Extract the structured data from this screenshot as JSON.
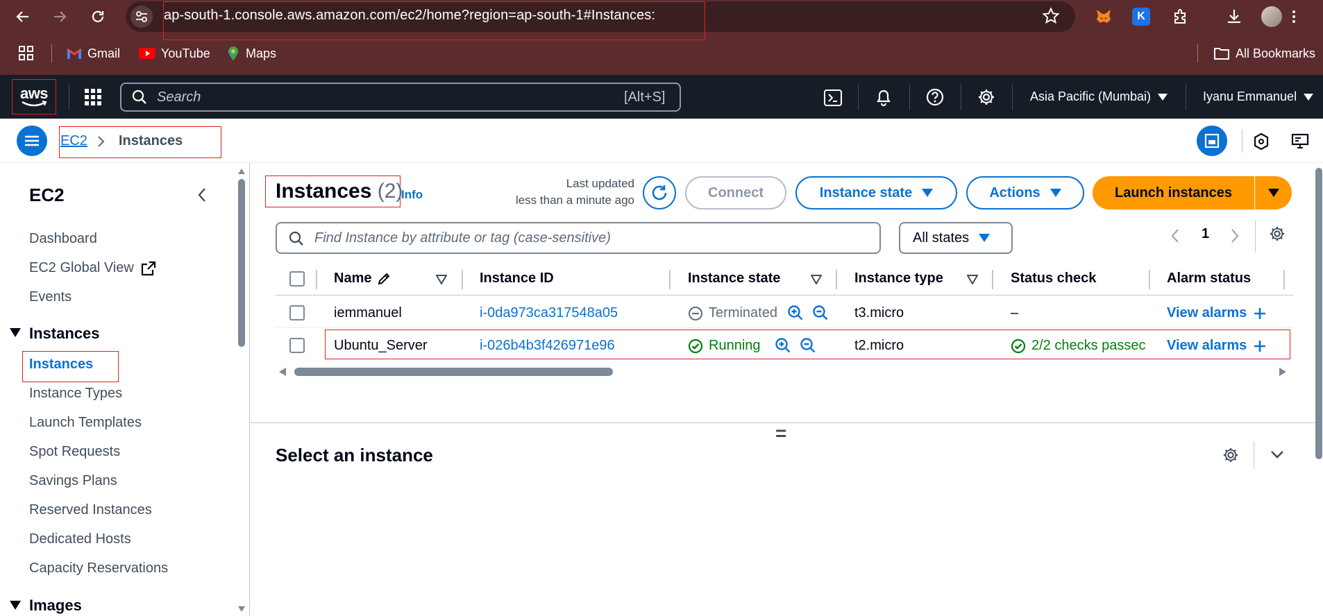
{
  "browser": {
    "url": "ap-south-1.console.aws.amazon.com/ec2/home?region=ap-south-1#Instances:",
    "bookmarks": [
      {
        "label": "Gmail"
      },
      {
        "label": "YouTube"
      },
      {
        "label": "Maps"
      }
    ],
    "all_bookmarks_label": "All Bookmarks",
    "extension_k_label": "K"
  },
  "aws_header": {
    "logo_text": "aws",
    "search_placeholder": "Search",
    "search_shortcut": "[Alt+S]",
    "region": "Asia Pacific (Mumbai)",
    "user": "Iyanu Emmanuel"
  },
  "breadcrumb": {
    "service": "EC2",
    "current": "Instances"
  },
  "sidebar": {
    "title": "EC2",
    "links": [
      "Dashboard",
      "EC2 Global View",
      "Events"
    ],
    "instances_section": "Instances",
    "instances_items": [
      "Instances",
      "Instance Types",
      "Launch Templates",
      "Spot Requests",
      "Savings Plans",
      "Reserved Instances",
      "Dedicated Hosts",
      "Capacity Reservations"
    ],
    "images_section": "Images"
  },
  "main": {
    "title": "Instances",
    "count": "(2)",
    "info": "Info",
    "last_updated_1": "Last updated",
    "last_updated_2": "less than a minute ago",
    "connect": "Connect",
    "instance_state": "Instance state",
    "actions": "Actions",
    "launch": "Launch instances",
    "filter_placeholder": "Find Instance by attribute or tag (case-sensitive)",
    "states_filter": "All states",
    "page": "1",
    "columns": [
      "Name",
      "Instance ID",
      "Instance state",
      "Instance type",
      "Status check",
      "Alarm status"
    ],
    "rows": [
      {
        "name": "iemmanuel",
        "id": "i-0da973ca317548a05",
        "state": "Terminated",
        "type": "t3.micro",
        "status": "–",
        "alarm": "View alarms"
      },
      {
        "name": "Ubuntu_Server",
        "id": "i-026b4b3f426971e96",
        "state": "Running",
        "type": "t2.micro",
        "status": "2/2 checks passec",
        "alarm": "View alarms"
      }
    ],
    "divider_glyph": "=",
    "details_title": "Select an instance"
  },
  "colors": {
    "chrome": "#5c2b2d",
    "aws_header": "#161d26",
    "link": "#0972d3",
    "primary": "#ff9900",
    "success": "#037f0c",
    "highlight": "#e02020"
  }
}
